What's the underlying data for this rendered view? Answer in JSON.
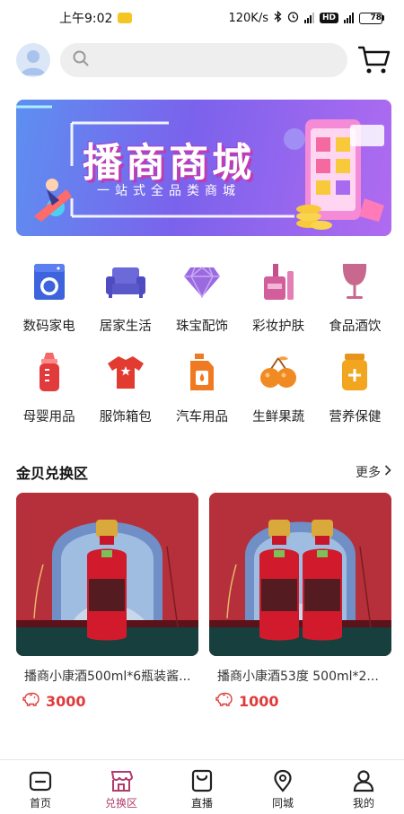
{
  "status_bar": {
    "time": "上午9:02",
    "network_speed": "120K/s",
    "battery": "78",
    "battery_fraction": 0.78
  },
  "search": {
    "placeholder": ""
  },
  "banner": {
    "title": "播商商城",
    "subtitle": "一站式全品类商城"
  },
  "categories": [
    {
      "label": "数码家电",
      "icon": "washing-machine-icon",
      "color": "#3d63dd"
    },
    {
      "label": "居家生活",
      "icon": "sofa-icon",
      "color": "#5b58c9"
    },
    {
      "label": "珠宝配饰",
      "icon": "diamond-icon",
      "color": "#9a6be0"
    },
    {
      "label": "彩妆护肤",
      "icon": "cosmetics-icon",
      "color": "#c74f8d"
    },
    {
      "label": "食品酒饮",
      "icon": "wine-glass-icon",
      "color": "#c9688f"
    },
    {
      "label": "母婴用品",
      "icon": "baby-bottle-icon",
      "color": "#e23b3b"
    },
    {
      "label": "服饰箱包",
      "icon": "tshirt-icon",
      "color": "#e23b30"
    },
    {
      "label": "汽车用品",
      "icon": "oil-can-icon",
      "color": "#f07a22"
    },
    {
      "label": "生鲜果蔬",
      "icon": "fruit-icon",
      "color": "#f08a22"
    },
    {
      "label": "营养保健",
      "icon": "supplement-jar-icon",
      "color": "#f2a51f"
    }
  ],
  "section": {
    "title": "金贝兑换区",
    "more_label": "更多"
  },
  "products": [
    {
      "title": "播商小康酒500ml*6瓶装酱...",
      "price": "3000",
      "bottles": 1
    },
    {
      "title": "播商小康酒53度 500ml*2...",
      "price": "1000",
      "bottles": 2
    }
  ],
  "bottom_nav": [
    {
      "label": "首页",
      "icon": "home-icon",
      "active": false
    },
    {
      "label": "兑换区",
      "icon": "store-icon",
      "active": true
    },
    {
      "label": "直播",
      "icon": "live-bag-icon",
      "active": false
    },
    {
      "label": "同城",
      "icon": "location-pin-icon",
      "active": false
    },
    {
      "label": "我的",
      "icon": "profile-icon",
      "active": false
    }
  ],
  "colors": {
    "accent": "#b23a6a",
    "price": "#e03b3b"
  }
}
